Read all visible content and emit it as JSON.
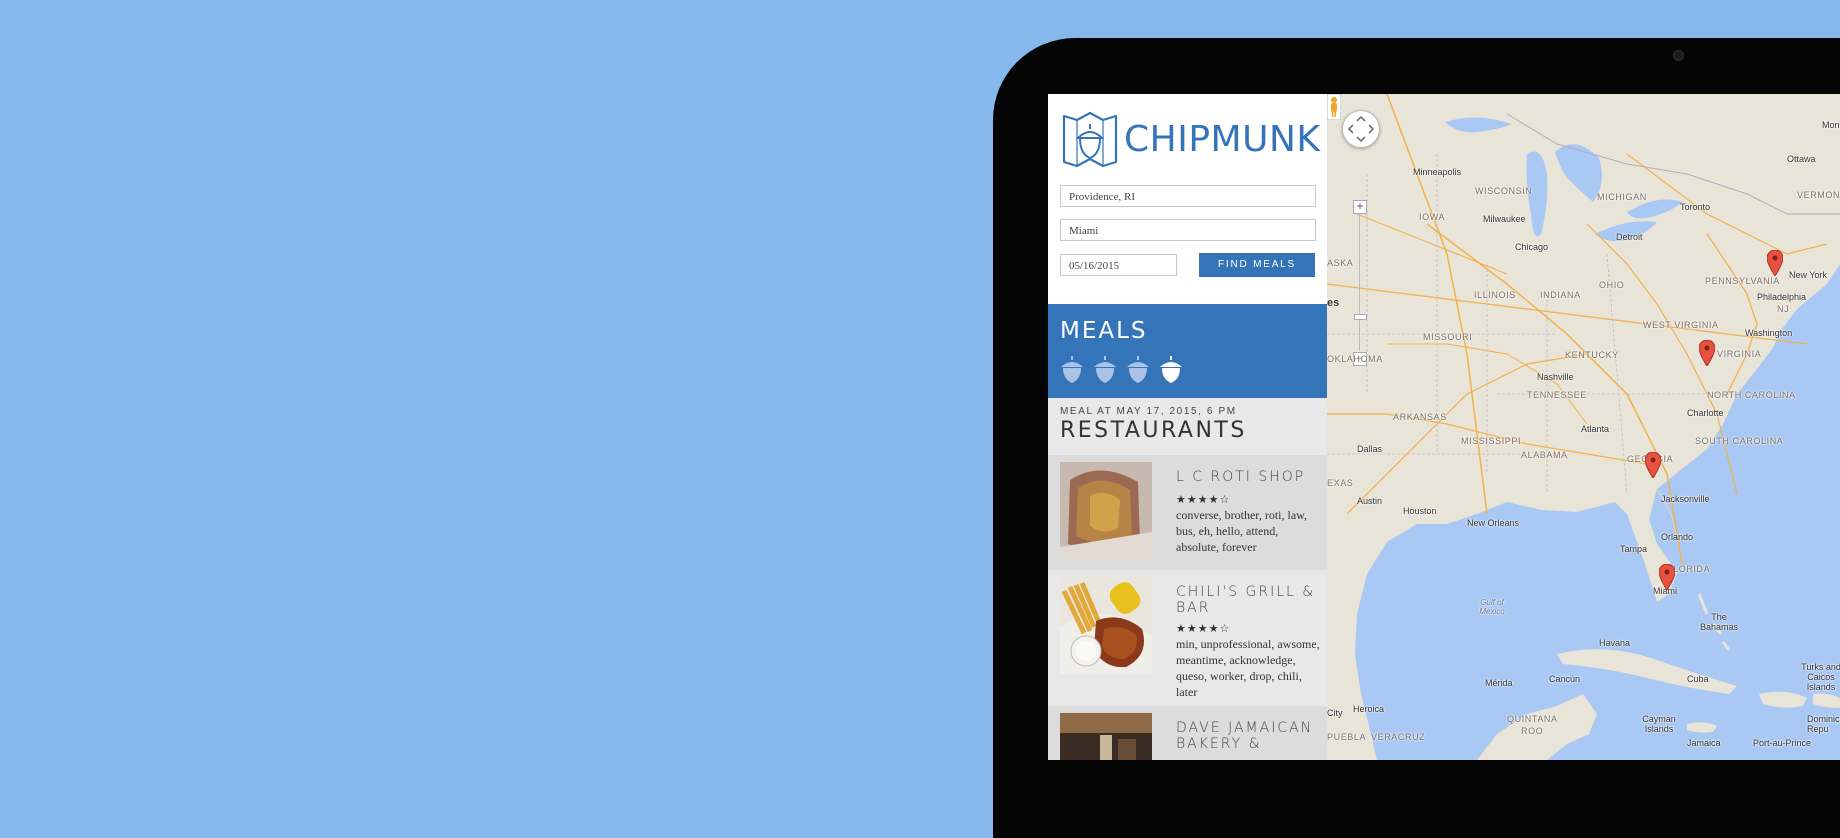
{
  "app": {
    "brand": "CHIPMUNK"
  },
  "search": {
    "origin_value": "Providence, RI",
    "destination_value": "Miami",
    "date_value": "05/16/2015",
    "find_label": "FIND MEALS"
  },
  "meals": {
    "title": "MEALS",
    "meal_count": 4,
    "active_meal_index": 3
  },
  "meal": {
    "date_label": "MEAL AT MAY 17, 2015, 6 PM",
    "section_title": "RESTAURANTS"
  },
  "restaurants": [
    {
      "name": "L C ROTI SHOP",
      "stars": "★★★★☆",
      "rating": 4,
      "tags": "converse, brother, roti, law, bus, eh, hello, attend, absolute, forever"
    },
    {
      "name": "CHILI'S GRILL & BAR",
      "stars": "★★★★☆",
      "rating": 4,
      "tags": "min, unprofessional, awsome, meantime, acknowledge, queso, worker, drop, chili, later"
    },
    {
      "name": "DAVE JAMAICAN BAKERY &",
      "stars": "",
      "rating": null,
      "tags": ""
    }
  ],
  "map": {
    "labels": {
      "ottawa": "Ottawa",
      "montreal": "Montre",
      "minneapolis": "Minneapolis",
      "wisconsin": "WISCONSIN",
      "michigan": "MICHIGAN",
      "toronto": "Toronto",
      "vermont": "VERMONT",
      "milwaukee": "Milwaukee",
      "iowa": "IOWA",
      "chicago": "Chicago",
      "detroit": "Detroit",
      "newyork": "New York",
      "pennsylvania": "PENNSYLVANIA",
      "philadelphia": "Philadelphia",
      "nj": "NJ",
      "illinois": "ILLINOIS",
      "indiana": "INDIANA",
      "ohio": "OHIO",
      "aska": "ASKA",
      "es": "es",
      "missouri": "MISSOURI",
      "westvirginia": "WEST VIRGINIA",
      "virginia": "VIRGINIA",
      "washington": "Washington",
      "kentucky": "KENTUCKY",
      "oklahoma": "OKLAHOMA",
      "nashville": "Nashville",
      "tennessee": "TENNESSEE",
      "northcarolina": "NORTH CAROLINA",
      "charlotte": "Charlotte",
      "arkansas": "ARKANSAS",
      "southcarolina": "SOUTH CAROLINA",
      "dallas": "Dallas",
      "mississippi": "MISSISSIPPI",
      "alabama": "ALABAMA",
      "atlanta": "Atlanta",
      "georgia": "GEORGIA",
      "exas": "EXAS",
      "austin": "Austin",
      "houston": "Houston",
      "jacksonville": "Jacksonville",
      "neworleans": "New Orleans",
      "orlando": "Orlando",
      "tampa": "Tampa",
      "florida": "FLORIDA",
      "miami": "Miami",
      "gulf": "Gulf of Mexico",
      "bahamas": "The Bahamas",
      "havana": "Havana",
      "cuba": "Cuba",
      "turks": "Turks and Caicos Islands",
      "merida": "Mérida",
      "cancun": "Cancún",
      "heroica": "Heroica",
      "city": "City",
      "quintana": "QUINTANA",
      "roo": "ROO",
      "puebla": "PUEBLA",
      "veracruz": "VERACRUZ",
      "cayman": "Cayman Islands",
      "jamaica": "Jamaica",
      "portauprince": "Port-au-Prince",
      "domrep": "Dominica Repu"
    },
    "markers": [
      "New York",
      "Virginia",
      "Georgia coast",
      "Miami"
    ],
    "colors": {
      "land": "#e9e4d8",
      "water": "#a9c8f4",
      "road": "#f2b24a",
      "marker": "#e8513f"
    }
  },
  "colors": {
    "background": "#87b8ec",
    "accent": "#3574b8"
  }
}
